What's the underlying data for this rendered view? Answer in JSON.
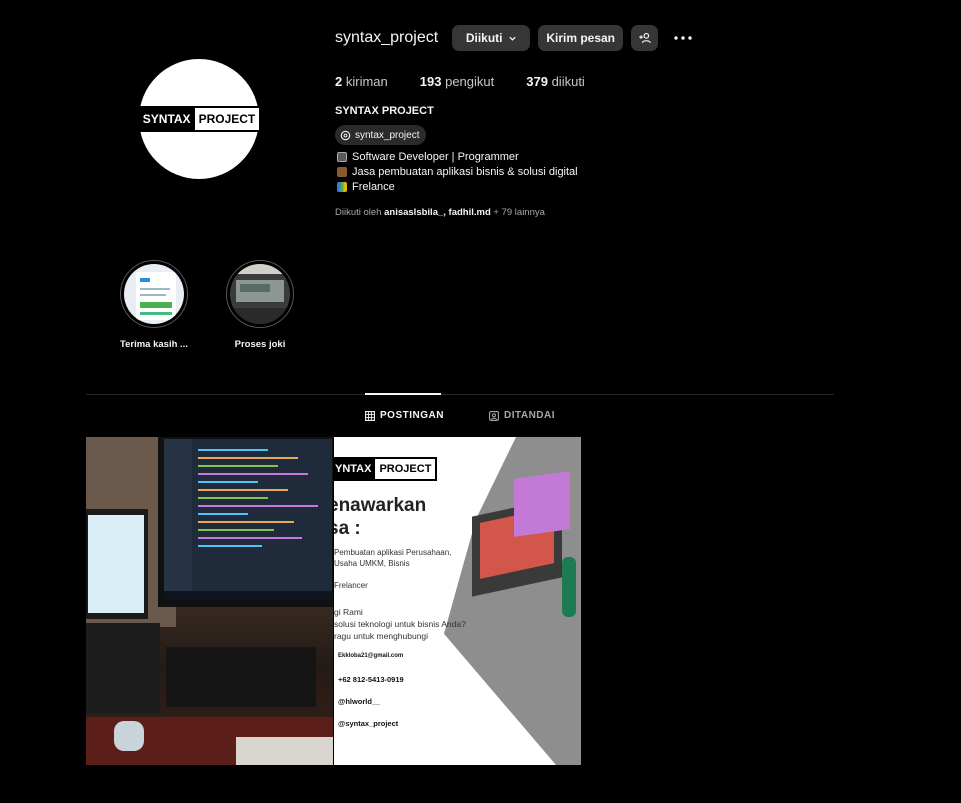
{
  "profile": {
    "username": "syntax_project",
    "logo_left": "SYNTAX",
    "logo_right": "PROJECT",
    "buttons": {
      "following": "Diikuti",
      "message": "Kirim pesan"
    },
    "stats": {
      "posts_count": "2",
      "posts_label": "kiriman",
      "followers_count": "193",
      "followers_label": "pengikut",
      "following_count": "379",
      "following_label": "diikuti"
    },
    "full_name": "SYNTAX PROJECT",
    "threads_handle": "syntax_project",
    "bio": [
      "Software Developer | Programmer",
      "Jasa pembuatan aplikasi bisnis & solusi digital",
      "Frelance"
    ],
    "followed_by": {
      "prefix": "Diikuti oleh",
      "names": "anisaslsbila_, fadhil.md",
      "suffix": "+ 79 lainnya"
    }
  },
  "highlights": [
    {
      "label": "Terima kasih ..."
    },
    {
      "label": "Proses joki"
    }
  ],
  "tabs": [
    {
      "label": "POSTINGAN",
      "icon": "grid-icon",
      "active": true
    },
    {
      "label": "DITANDAI",
      "icon": "tagged-icon",
      "active": false
    }
  ],
  "post2": {
    "logo_left": "YNTAX",
    "logo_right": "PROJECT",
    "heading1": "enawarkan",
    "heading2": "sa :",
    "line1": "Pembuatan aplikasi Perusahaan,",
    "line2": "Usaha UMKM, Bisnis",
    "line3": "Frelancer",
    "line4": "gi Rami",
    "line5": "solusi teknologi untuk bisnis Anda?",
    "line6": "ragu untuk menghubungi",
    "email": "Ekkloba21@gmail.com",
    "phone": "+62 812-5413-0919",
    "ig1": "@hlworld__",
    "ig2": "@syntax_project"
  },
  "colors": {
    "background": "#000000",
    "button": "#363636",
    "muted": "#a8a8a8"
  }
}
